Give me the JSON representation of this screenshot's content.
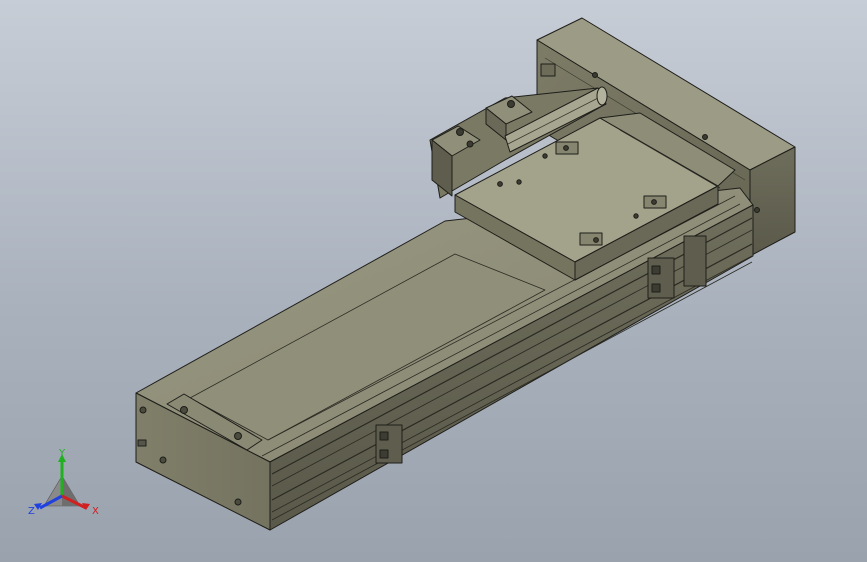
{
  "viewport": {
    "background_top": "#c7cdd6",
    "background_bottom": "#9aa2ae",
    "model_color": "#8c8b76",
    "edge_color": "#1e1e1a"
  },
  "triad": {
    "x_label": "X",
    "y_label": "Y",
    "z_label": "Z",
    "x_color": "#d02020",
    "y_color": "#20b020",
    "z_color": "#2040e0"
  }
}
